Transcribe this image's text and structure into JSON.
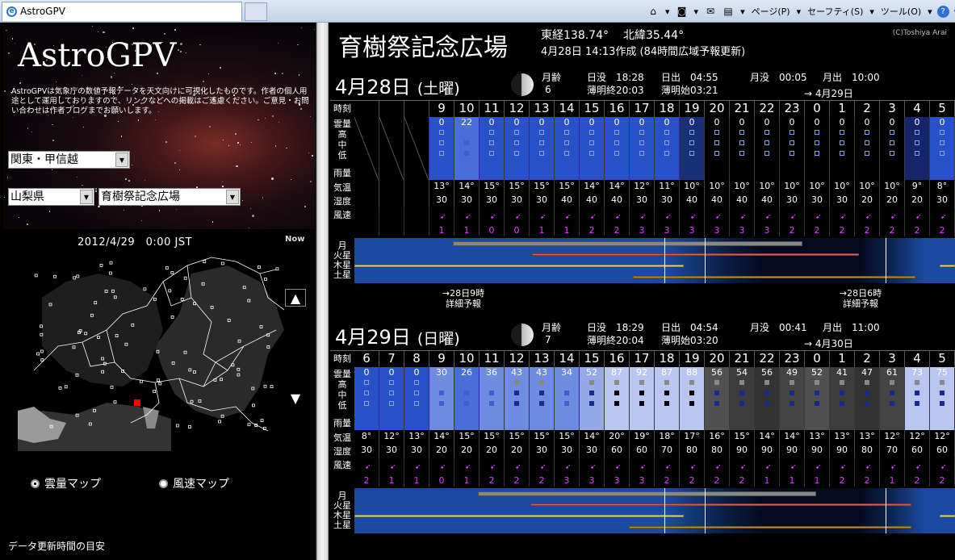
{
  "browser": {
    "tab_title": "AstroGPV",
    "page_menu": "ページ(P)",
    "safety_menu": "セーフティ(S)",
    "tools_menu": "ツール(O)",
    "help_menu": "?"
  },
  "sidebar": {
    "logo": "AstroGPV",
    "intro": "AstroGPVは気象庁の数値予報データを天文向けに可視化したものです。作者の個人用途として運用しておりますので、リンクなどへの掲載はご遠慮ください。ご意見・お問い合わせは作者ブログまでお願いします。",
    "region": "関東・甲信越",
    "prefecture": "山梨県",
    "site": "育樹祭記念広場",
    "map_datetime": "2012/4/29　0:00 JST",
    "map_now": "Now",
    "radio_cloud": "雲量マップ",
    "radio_wind": "風速マップ",
    "update_note": "データ更新時間の目安"
  },
  "header": {
    "place": "育樹祭記念広場",
    "lon": "東経138.74°",
    "lat": "北緯35.44°",
    "created": "4月28日 14:13作成 (84時間広域予報更新)",
    "credit": "(C)Toshiya Arai"
  },
  "labels": {
    "hour": "時刻",
    "cloud": "雲量",
    "high": "高",
    "mid": "中",
    "low": "低",
    "rain": "雨量",
    "temp": "気温",
    "humid": "湿度",
    "wind": "風速",
    "moon": "月",
    "mars": "火星",
    "jupiter": "木星",
    "saturn": "土星"
  },
  "days": [
    {
      "date": "4月28日",
      "dow": "(土曜)",
      "moon_age_label": "月齢",
      "moon_age": "6",
      "sunset": "日没　18:28",
      "sunrise": "日出　04:55",
      "dusk_end": "薄明終20:03",
      "dawn_start": "薄明始03:21",
      "moonset": "月没　00:05",
      "moonrise": "月出　10:00",
      "next": "→ 4月29日",
      "hours": [
        "",
        "",
        "",
        "9",
        "10",
        "11",
        "12",
        "13",
        "14",
        "15",
        "16",
        "17",
        "18",
        "19",
        "20",
        "21",
        "22",
        "23",
        "0",
        "1",
        "2",
        "3",
        "4",
        "5"
      ],
      "cloud": [
        "",
        "",
        "",
        "0",
        "22",
        "0",
        "0",
        "0",
        "0",
        "0",
        "0",
        "0",
        "0",
        "0",
        "0",
        "0",
        "0",
        "0",
        "0",
        "0",
        "0",
        "0",
        "0",
        "0"
      ],
      "temp": [
        "",
        "",
        "",
        "13°",
        "14°",
        "15°",
        "15°",
        "15°",
        "15°",
        "14°",
        "14°",
        "12°",
        "11°",
        "10°",
        "10°",
        "10°",
        "10°",
        "10°",
        "10°",
        "10°",
        "10°",
        "10°",
        "9°",
        "8°"
      ],
      "humid": [
        "",
        "",
        "",
        "30",
        "30",
        "30",
        "30",
        "30",
        "40",
        "40",
        "40",
        "30",
        "30",
        "40",
        "40",
        "40",
        "40",
        "30",
        "30",
        "30",
        "20",
        "20",
        "20",
        "30"
      ],
      "wind": [
        "",
        "",
        "",
        "1",
        "1",
        "0",
        "0",
        "1",
        "1",
        "2",
        "2",
        "3",
        "3",
        "3",
        "3",
        "3",
        "3",
        "2",
        "2",
        "2",
        "2",
        "2",
        "2",
        "2"
      ],
      "note_left": "→28日9時\n詳細予報",
      "note_right": "→28日6時\n詳細予報"
    },
    {
      "date": "4月29日",
      "dow": "(日曜)",
      "moon_age_label": "月齢",
      "moon_age": "7",
      "sunset": "日没　18:29",
      "sunrise": "日出　04:54",
      "dusk_end": "薄明終20:04",
      "dawn_start": "薄明始03:20",
      "moonset": "月没　00:41",
      "moonrise": "月出　11:00",
      "next": "→ 4月30日",
      "hours": [
        "6",
        "7",
        "8",
        "9",
        "10",
        "11",
        "12",
        "13",
        "14",
        "15",
        "16",
        "17",
        "18",
        "19",
        "20",
        "21",
        "22",
        "23",
        "0",
        "1",
        "2",
        "3",
        "4",
        "5"
      ],
      "cloud": [
        "0",
        "0",
        "0",
        "30",
        "26",
        "36",
        "43",
        "43",
        "34",
        "52",
        "87",
        "92",
        "87",
        "88",
        "56",
        "54",
        "56",
        "49",
        "52",
        "41",
        "47",
        "61",
        "73",
        "75"
      ],
      "temp": [
        "8°",
        "12°",
        "13°",
        "14°",
        "15°",
        "15°",
        "15°",
        "15°",
        "15°",
        "14°",
        "20°",
        "19°",
        "18°",
        "17°",
        "16°",
        "15°",
        "14°",
        "14°",
        "13°",
        "13°",
        "13°",
        "12°",
        "12°",
        "12°"
      ],
      "humid": [
        "30",
        "30",
        "30",
        "20",
        "20",
        "20",
        "20",
        "30",
        "30",
        "30",
        "60",
        "60",
        "70",
        "80",
        "80",
        "90",
        "90",
        "90",
        "90",
        "90",
        "80",
        "70",
        "60",
        "60"
      ],
      "wind": [
        "2",
        "1",
        "1",
        "0",
        "1",
        "2",
        "2",
        "2",
        "3",
        "3",
        "3",
        "3",
        "2",
        "2",
        "2",
        "2",
        "1",
        "1",
        "1",
        "2",
        "2",
        "1",
        "2",
        "2"
      ]
    }
  ],
  "colors": {
    "clear": "#2a52c8",
    "accent": "#e040ff"
  }
}
